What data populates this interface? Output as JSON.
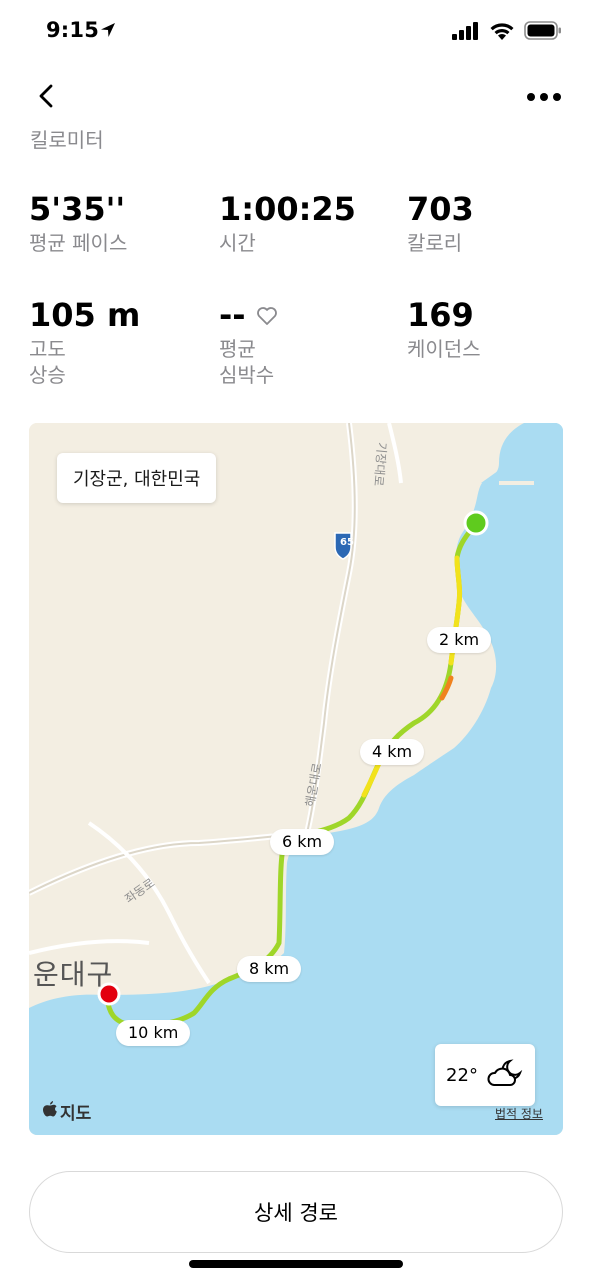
{
  "status_bar": {
    "time": "9:15",
    "icons": [
      "location-arrow-icon",
      "signal-icon",
      "wifi-icon",
      "battery-icon"
    ]
  },
  "nav": {
    "back_icon": "chevron-left-icon",
    "more_icon": "ellipsis-icon"
  },
  "unit": "킬로미터",
  "metrics": {
    "pace": {
      "value": "5'35''",
      "label": "평균 페이스"
    },
    "time": {
      "value": "1:00:25",
      "label": "시간"
    },
    "calories": {
      "value": "703",
      "label": "칼로리"
    },
    "elevation": {
      "value": "105 m",
      "label_line1": "고도",
      "label_line2": "상승"
    },
    "heart_rate": {
      "value": "--",
      "label_line1": "평균",
      "label_line2": "심박수",
      "icon": "heart-outline-icon"
    },
    "cadence": {
      "value": "169",
      "label": "케이던스"
    }
  },
  "map": {
    "location": "기장군, 대한민국",
    "district": "운대구",
    "km_markers": [
      "2 km",
      "4 km",
      "6 km",
      "8 km",
      "10 km"
    ],
    "road_labels": {
      "highway_number": "65",
      "road1": "기장대로",
      "road2": "해운대로",
      "road3": "좌동로"
    },
    "weather": {
      "temperature": "22°",
      "icon": "cloudy-night-icon"
    },
    "brand": "지도",
    "legal": "법적 정보",
    "colors": {
      "water": "#aadcf2",
      "land": "#f3eee2",
      "start": "#5fcb1e",
      "end": "#e3000f"
    }
  },
  "detail_button": "상세 경로"
}
